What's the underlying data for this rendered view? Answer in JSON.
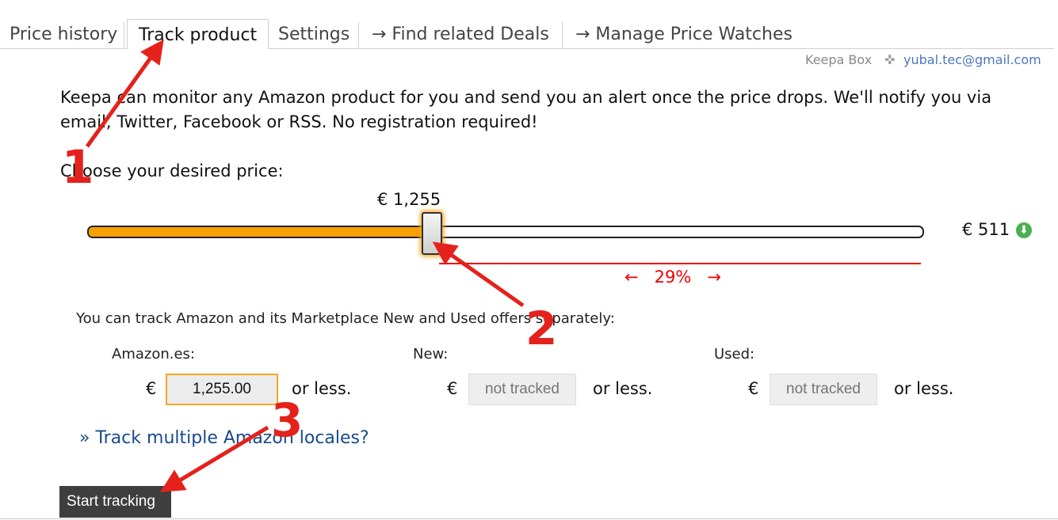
{
  "tabs": [
    {
      "label": "Price history",
      "active": false
    },
    {
      "label": "Track product",
      "active": true
    },
    {
      "label": "Settings",
      "active": false
    },
    {
      "label": "→  Find related Deals",
      "active": false
    },
    {
      "label": "→  Manage Price Watches",
      "active": false
    }
  ],
  "account": {
    "box_label": "Keepa Box",
    "separator": "✜",
    "email": "yubal.tec@gmail.com"
  },
  "intro": "Keepa can monitor any Amazon product for you and send you an alert once the price drops. We'll notify you via email, Twitter, Facebook or RSS. No registration required!",
  "choose_label": "Choose your desired price:",
  "slider": {
    "selected_label": "€ 1,255",
    "max_label": "€ 511",
    "fill_fraction": 0.41,
    "percent_label": "←   29%   →"
  },
  "track_note": "You can track Amazon and its Marketplace New and Used offers separately:",
  "columns": [
    {
      "label": "Amazon.es:",
      "currency": "€",
      "value": "1,255.00",
      "placeholder": "",
      "suffix": "or less."
    },
    {
      "label": "New:",
      "currency": "€",
      "value": "",
      "placeholder": "not tracked",
      "suffix": "or less."
    },
    {
      "label": "Used:",
      "currency": "€",
      "value": "",
      "placeholder": "not tracked",
      "suffix": "or less."
    }
  ],
  "multi_locale_link": "» Track multiple Amazon locales?",
  "start_button": "Start tracking",
  "annotations": [
    "1",
    "2",
    "3"
  ],
  "colors": {
    "accent": "#f7a000",
    "link": "#1a4b8c",
    "annotation": "#e5211c",
    "button": "#3e3e3e"
  }
}
